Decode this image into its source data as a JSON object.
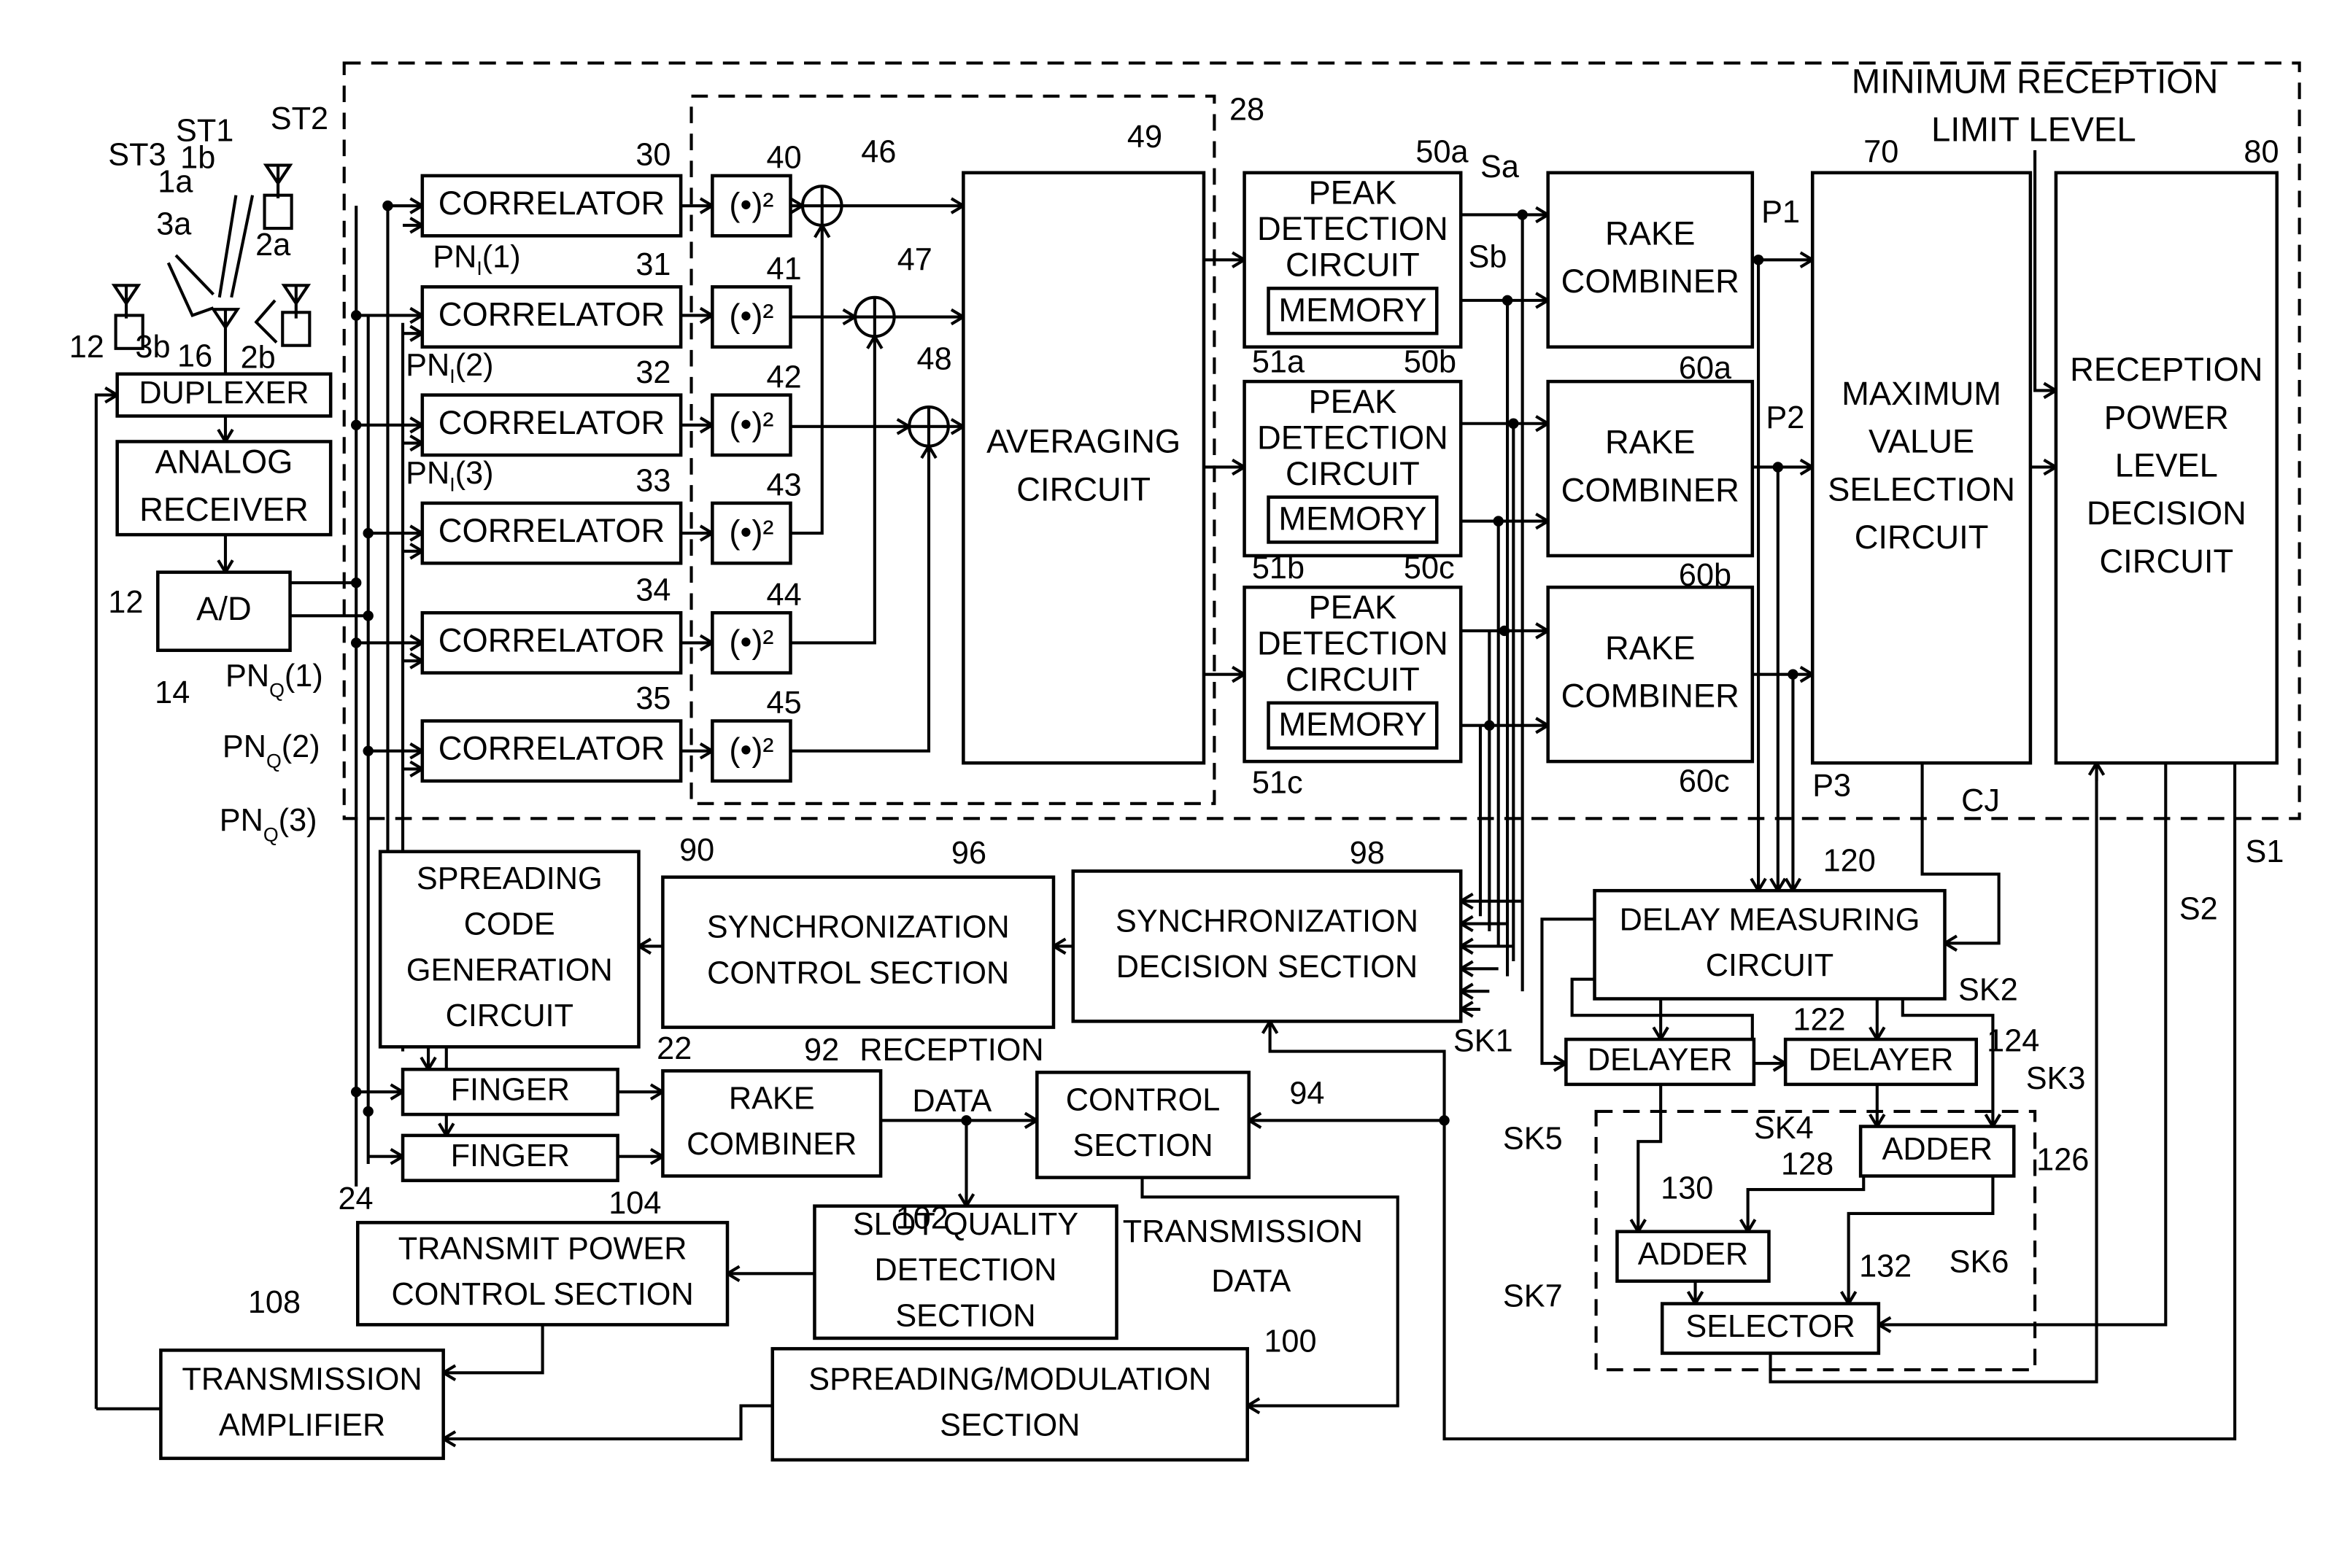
{
  "figure": {
    "title_note": "MINIMUM RECEPTION LIMIT LEVEL",
    "title_note_lines": [
      "MINIMUM RECEPTION",
      "LIMIT LEVEL"
    ]
  },
  "antennas": {
    "stations": [
      "ST1",
      "ST2",
      "ST3"
    ],
    "paths": [
      "1a",
      "1b",
      "2a",
      "2b",
      "3a",
      "3b"
    ],
    "base_antenna_ref": "16"
  },
  "blocks": {
    "duplexer": {
      "ref": "12",
      "lines": [
        "DUPLEXER"
      ]
    },
    "analog_receiver": {
      "ref": "12",
      "lines": [
        "ANALOG",
        "RECEIVER"
      ]
    },
    "ad": {
      "ref": "14",
      "lines": [
        "A/D"
      ]
    },
    "correlators": [
      {
        "ref": "30",
        "lines": [
          "CORRELATOR"
        ]
      },
      {
        "ref": "31",
        "lines": [
          "CORRELATOR"
        ]
      },
      {
        "ref": "32",
        "lines": [
          "CORRELATOR"
        ]
      },
      {
        "ref": "33",
        "lines": [
          "CORRELATOR"
        ]
      },
      {
        "ref": "34",
        "lines": [
          "CORRELATOR"
        ]
      },
      {
        "ref": "35",
        "lines": [
          "CORRELATOR"
        ]
      }
    ],
    "squarers": [
      {
        "ref": "40",
        "label": "(•)²"
      },
      {
        "ref": "41",
        "label": "(•)²"
      },
      {
        "ref": "42",
        "label": "(•)²"
      },
      {
        "ref": "43",
        "label": "(•)²"
      },
      {
        "ref": "44",
        "label": "(•)²"
      },
      {
        "ref": "45",
        "label": "(•)²"
      }
    ],
    "summers": [
      {
        "ref": "46"
      },
      {
        "ref": "47"
      },
      {
        "ref": "48"
      }
    ],
    "averaging": {
      "ref": "49",
      "lines": [
        "AVERAGING",
        "CIRCUIT"
      ]
    },
    "group_ref": "28",
    "peak_detectors": [
      {
        "ref": "50a",
        "mem_ref": "51a",
        "lines": [
          "PEAK",
          "DETECTION",
          "CIRCUIT"
        ],
        "memory": "MEMORY"
      },
      {
        "ref": "50b",
        "mem_ref": "51b",
        "lines": [
          "PEAK",
          "DETECTION",
          "CIRCUIT"
        ],
        "memory": "MEMORY"
      },
      {
        "ref": "50c",
        "mem_ref": "51c",
        "lines": [
          "PEAK",
          "DETECTION",
          "CIRCUIT"
        ],
        "memory": "MEMORY"
      }
    ],
    "rake_combiners": [
      {
        "ref": "60a",
        "lines": [
          "RAKE",
          "COMBINER"
        ]
      },
      {
        "ref": "60b",
        "lines": [
          "RAKE",
          "COMBINER"
        ]
      },
      {
        "ref": "60c",
        "lines": [
          "RAKE",
          "COMBINER"
        ]
      }
    ],
    "max_select": {
      "ref": "70",
      "lines": [
        "MAXIMUM",
        "VALUE",
        "SELECTION",
        "CIRCUIT"
      ]
    },
    "power_decision": {
      "ref": "80",
      "lines": [
        "RECEPTION",
        "POWER",
        "LEVEL",
        "DECISION",
        "CIRCUIT"
      ]
    },
    "spreading_code": {
      "ref": "90",
      "lines": [
        "SPREADING",
        "CODE",
        "GENERATION",
        "CIRCUIT"
      ]
    },
    "sync_control": {
      "ref": "96",
      "lines": [
        "SYNCHRONIZATION",
        "CONTROL SECTION"
      ]
    },
    "sync_decision": {
      "ref": "98",
      "lines": [
        "SYNCHRONIZATION",
        "DECISION SECTION"
      ]
    },
    "delay_measuring": {
      "ref": "120",
      "lines": [
        "DELAY MEASURING",
        "CIRCUIT"
      ]
    },
    "finger1": {
      "ref": "22",
      "lines": [
        "FINGER"
      ]
    },
    "finger2": {
      "ref": "24",
      "lines": [
        "FINGER"
      ]
    },
    "rake_main": {
      "ref": "92",
      "lines": [
        "RAKE",
        "COMBINER"
      ]
    },
    "control": {
      "ref": "94",
      "lines": [
        "CONTROL",
        "SECTION"
      ]
    },
    "slot_quality": {
      "ref": "102",
      "lines": [
        "SLOT QUALITY",
        "DETECTION",
        "SECTION"
      ]
    },
    "tx_power_ctrl": {
      "ref": "104",
      "lines": [
        "TRANSMIT POWER",
        "CONTROL SECTION"
      ]
    },
    "tx_amp": {
      "ref": "108",
      "lines": [
        "TRANSMISSION",
        "AMPLIFIER"
      ]
    },
    "spread_mod": {
      "ref": "100",
      "lines": [
        "SPREADING/MODULATION",
        "SECTION"
      ]
    },
    "delayer1": {
      "ref": "122",
      "lines": [
        "DELAYER"
      ]
    },
    "delayer2": {
      "ref": "124",
      "lines": [
        "DELAYER"
      ]
    },
    "adder1": {
      "ref": "128",
      "lines": [
        "ADDER"
      ]
    },
    "adder2": {
      "ref": "130",
      "lines": [
        "ADDER"
      ]
    },
    "selector": {
      "ref": "132",
      "lines": [
        "SELECTOR"
      ]
    },
    "dsp_group_ref": "126"
  },
  "signals": {
    "pn_i": [
      "PN₁(1)",
      "PN₁(2)",
      "PN₁(3)"
    ],
    "pn_i_base": "PN",
    "pn_i_sub": "I",
    "pn_q_base": "PN",
    "pn_q_sub": "Q",
    "pn_idx": [
      "(1)",
      "(2)",
      "(3)"
    ],
    "sa": "Sa",
    "sb": "Sb",
    "p": [
      "P1",
      "P2",
      "P3"
    ],
    "cj": "CJ",
    "s1": "S1",
    "s2": "S2",
    "sk": [
      "SK1",
      "SK2",
      "SK3",
      "SK4",
      "SK5",
      "SK6",
      "SK7"
    ],
    "reception_data": [
      "RECEPTION",
      "DATA"
    ],
    "transmission_data": [
      "TRANSMISSION",
      "DATA"
    ]
  }
}
